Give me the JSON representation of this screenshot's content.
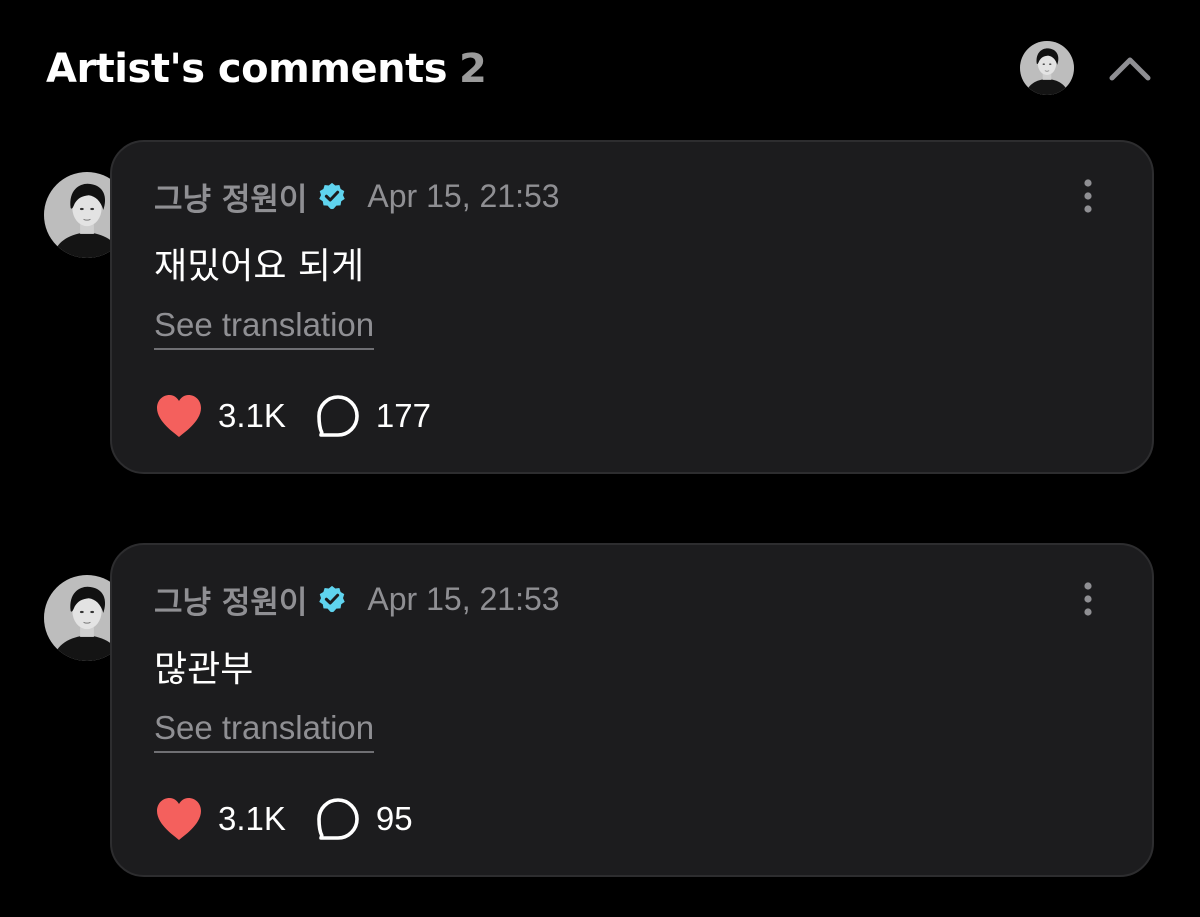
{
  "header": {
    "title": "Artist's comments",
    "count": "2",
    "collapse_icon": "chevron-up-icon"
  },
  "colors": {
    "background": "#000000",
    "card": "#1c1c1e",
    "muted_text": "#8f8f93",
    "verified": "#5fd4ef",
    "heart": "#f4605d"
  },
  "comments": [
    {
      "author": "그냥 정원이",
      "verified_icon": "verified-badge-icon",
      "timestamp": "Apr 15, 21:53",
      "text": "재밌어요 되게",
      "translate_label": "See translation",
      "likes": "3.1K",
      "replies": "177"
    },
    {
      "author": "그냥 정원이",
      "verified_icon": "verified-badge-icon",
      "timestamp": "Apr 15, 21:53",
      "text": "많관부",
      "translate_label": "See translation",
      "likes": "3.1K",
      "replies": "95"
    }
  ]
}
